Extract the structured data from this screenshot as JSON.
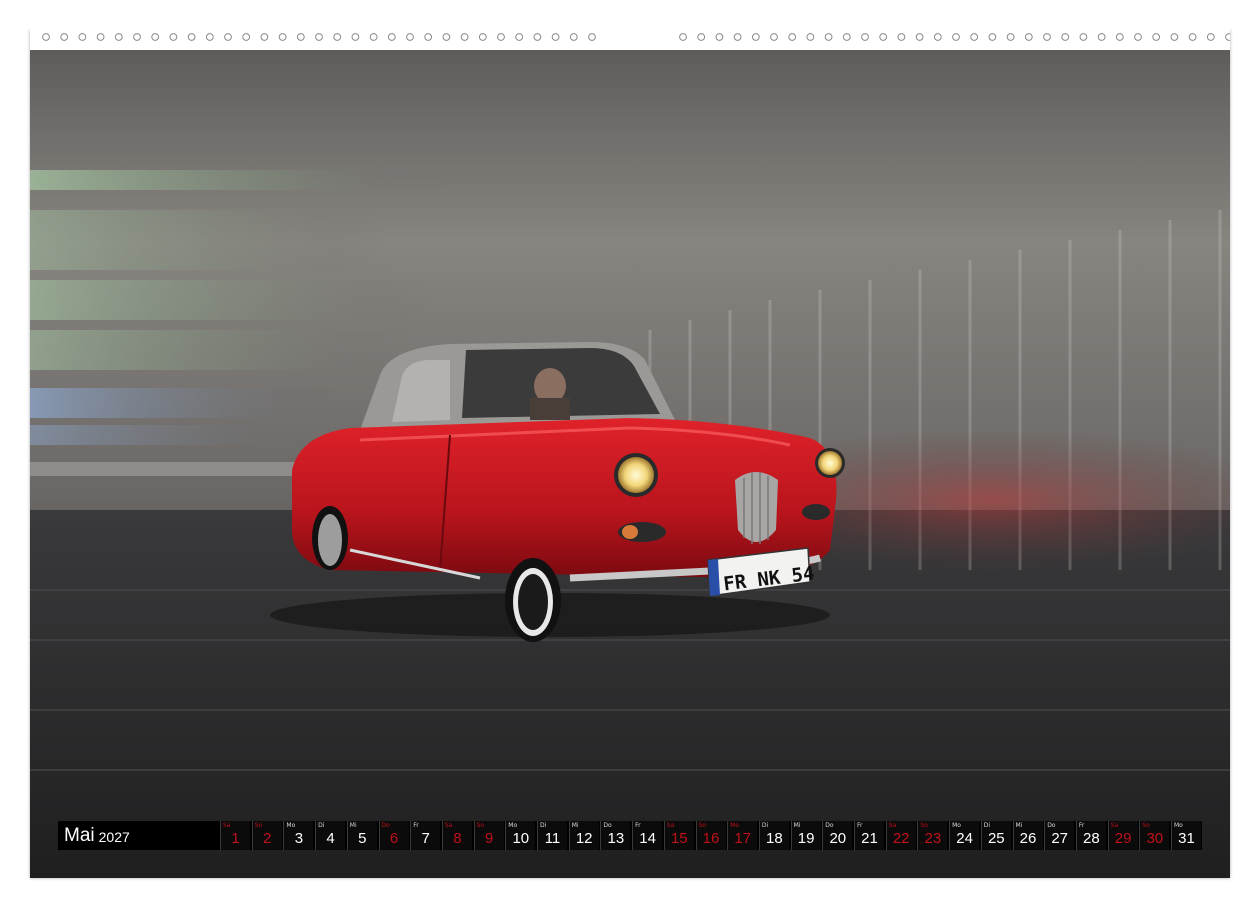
{
  "calendar": {
    "month": "Mai",
    "year": "2027",
    "weekend_color": "#c0101a",
    "days": [
      {
        "num": "1",
        "wd": "Sa",
        "red": true
      },
      {
        "num": "2",
        "wd": "So",
        "red": true
      },
      {
        "num": "3",
        "wd": "Mo",
        "red": false
      },
      {
        "num": "4",
        "wd": "Di",
        "red": false
      },
      {
        "num": "5",
        "wd": "Mi",
        "red": false
      },
      {
        "num": "6",
        "wd": "Do",
        "red": true
      },
      {
        "num": "7",
        "wd": "Fr",
        "red": false
      },
      {
        "num": "8",
        "wd": "Sa",
        "red": true
      },
      {
        "num": "9",
        "wd": "So",
        "red": true
      },
      {
        "num": "10",
        "wd": "Mo",
        "red": false
      },
      {
        "num": "11",
        "wd": "Di",
        "red": false
      },
      {
        "num": "12",
        "wd": "Mi",
        "red": false
      },
      {
        "num": "13",
        "wd": "Do",
        "red": false
      },
      {
        "num": "14",
        "wd": "Fr",
        "red": false
      },
      {
        "num": "15",
        "wd": "Sa",
        "red": true
      },
      {
        "num": "16",
        "wd": "So",
        "red": true
      },
      {
        "num": "17",
        "wd": "Mo",
        "red": true
      },
      {
        "num": "18",
        "wd": "Di",
        "red": false
      },
      {
        "num": "19",
        "wd": "Mi",
        "red": false
      },
      {
        "num": "20",
        "wd": "Do",
        "red": false
      },
      {
        "num": "21",
        "wd": "Fr",
        "red": false
      },
      {
        "num": "22",
        "wd": "Sa",
        "red": true
      },
      {
        "num": "23",
        "wd": "So",
        "red": true
      },
      {
        "num": "24",
        "wd": "Mo",
        "red": false
      },
      {
        "num": "25",
        "wd": "Di",
        "red": false
      },
      {
        "num": "26",
        "wd": "Mi",
        "red": false
      },
      {
        "num": "27",
        "wd": "Do",
        "red": false
      },
      {
        "num": "28",
        "wd": "Fr",
        "red": false
      },
      {
        "num": "29",
        "wd": "Sa",
        "red": true
      },
      {
        "num": "30",
        "wd": "So",
        "red": true
      },
      {
        "num": "31",
        "wd": "Mo",
        "red": false
      }
    ]
  },
  "photo": {
    "subject": "red-vintage-coupe",
    "license_plate": "FR NK 54",
    "car_color": "#c4141c"
  }
}
